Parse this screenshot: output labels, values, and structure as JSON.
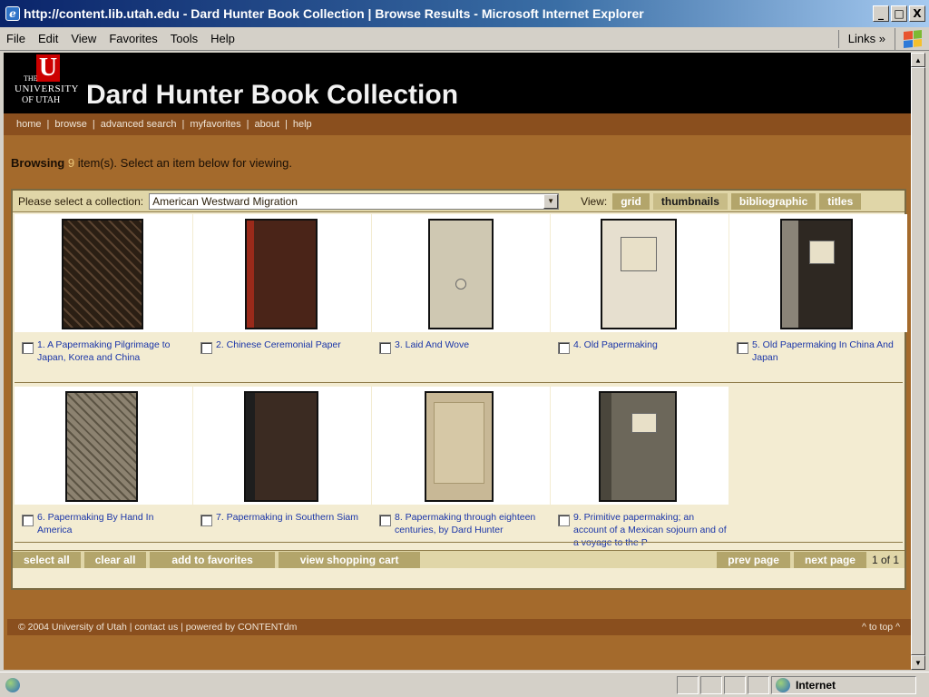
{
  "window": {
    "title": "http://content.lib.utah.edu - Dard Hunter Book Collection | Browse Results - Microsoft Internet Explorer",
    "buttons": [
      "_",
      "□",
      "X"
    ]
  },
  "menu": {
    "items": [
      "File",
      "Edit",
      "View",
      "Favorites",
      "Tools",
      "Help"
    ],
    "links_label": "Links »"
  },
  "header": {
    "logo": {
      "the": "THE",
      "university": "UNIVERSITY",
      "of_utah": "OF UTAH",
      "letter": "U"
    },
    "title": "Dard Hunter Book Collection"
  },
  "nav": {
    "items": [
      "home",
      "browse",
      "advanced search",
      "myfavorites",
      "about",
      "help"
    ]
  },
  "browse": {
    "prefix": "Browsing",
    "count": "9",
    "suffix": "item(s). Select an item below for viewing."
  },
  "controls": {
    "collection_label": "Please select a collection:",
    "collection_value": "American Westward Migration",
    "view_label": "View:",
    "view_buttons": [
      "grid",
      "thumbnails",
      "bibliographic",
      "titles"
    ],
    "active_view": "thumbnails"
  },
  "items": [
    {
      "label": "1. A Papermaking Pilgrimage to Japan, Korea and China",
      "cover": "#3a2a1a"
    },
    {
      "label": "2. Chinese Ceremonial Paper",
      "cover": "#5a2a18"
    },
    {
      "label": "3. Laid And Wove",
      "cover": "#cfc8b2"
    },
    {
      "label": "4. Old Papermaking",
      "cover": "#e6dfcf"
    },
    {
      "label": "5. Old Papermaking In China And Japan",
      "cover": "#3a3028"
    },
    {
      "label": "6. Papermaking By Hand In America",
      "cover": "#7a705e"
    },
    {
      "label": "7. Papermaking in Southern Siam",
      "cover": "#3b2b22"
    },
    {
      "label": "8. Papermaking through eighteen centuries, by Dard Hunter",
      "cover": "#c8b896"
    },
    {
      "label": "9. Primitive papermaking; an account of a Mexican sojourn and of a voyage to the P",
      "cover": "#6c675a"
    }
  ],
  "bottom": {
    "buttons": [
      "select all",
      "clear all",
      "add to favorites",
      "view shopping cart"
    ],
    "prev": "prev page",
    "next": "next page",
    "page_info": "1 of 1"
  },
  "footer": {
    "text": "© 2004 University of Utah  |  contact us  |  powered by CONTENTdm",
    "to_top": "^ to top ^"
  },
  "status": {
    "zone": "Internet"
  },
  "colors": {
    "page_bg": "#a46a2c",
    "nav_bg": "#8a4f1e",
    "button_bg": "#b3a56b",
    "link": "#1a35a8"
  }
}
